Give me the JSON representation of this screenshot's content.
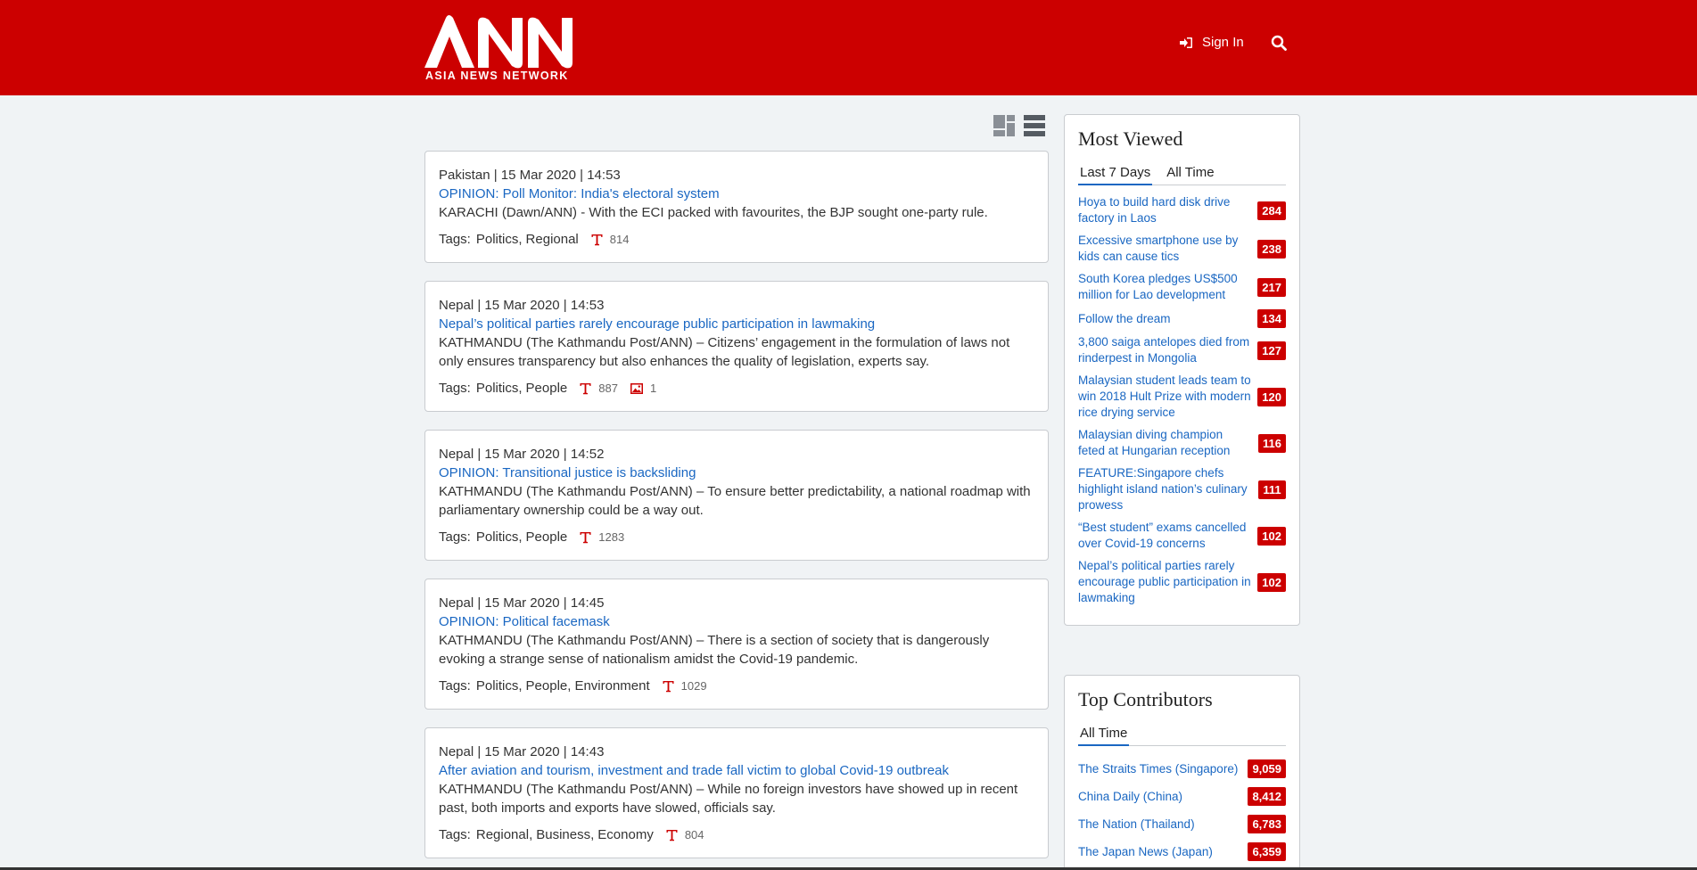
{
  "header": {
    "logo_main": "ANN",
    "logo_sub": "ASIA NEWS NETWORK",
    "signin_label": "Sign In"
  },
  "articles": [
    {
      "meta": "Pakistan | 15 Mar 2020 | 14:53",
      "title": "OPINION: Poll Monitor: India's electoral system",
      "summary": "KARACHI (Dawn/ANN) - With the ECI packed with favourites, the BJP sought one-party rule.",
      "tags_label": "Tags:",
      "tags": [
        "Politics",
        "Regional"
      ],
      "views": "814",
      "images": null
    },
    {
      "meta": "Nepal | 15 Mar 2020 | 14:53",
      "title": "Nepal’s political parties rarely encourage public participation in lawmaking",
      "summary": "KATHMANDU (The Kathmandu Post/ANN) – Citizens’ engagement in the formulation of laws not only ensures transparency but also enhances the quality of legislation, experts say.",
      "tags_label": "Tags:",
      "tags": [
        "Politics",
        "People"
      ],
      "views": "887",
      "images": "1"
    },
    {
      "meta": "Nepal | 15 Mar 2020 | 14:52",
      "title": "OPINION: Transitional justice is backsliding",
      "summary": "KATHMANDU (The Kathmandu Post/ANN) – To ensure better predictability, a national roadmap with parliamentary ownership could be a way out.",
      "tags_label": "Tags:",
      "tags": [
        "Politics",
        "People"
      ],
      "views": "1283",
      "images": null
    },
    {
      "meta": "Nepal | 15 Mar 2020 | 14:45",
      "title": "OPINION: Political facemask",
      "summary": "KATHMANDU (The Kathmandu Post/ANN) – There is a section of society that is dangerously evoking a strange sense of nationalism amidst the Covid-19 pandemic.",
      "tags_label": "Tags:",
      "tags": [
        "Politics",
        "People",
        "Environment"
      ],
      "views": "1029",
      "images": null
    },
    {
      "meta": "Nepal | 15 Mar 2020 | 14:43",
      "title": "After aviation and tourism, investment and trade fall victim to global Covid-19 outbreak",
      "summary": "KATHMANDU (The Kathmandu Post/ANN) – While no foreign investors have showed up in recent past, both imports and exports have slowed, officials say.",
      "tags_label": "Tags:",
      "tags": [
        "Regional",
        "Business",
        "Economy"
      ],
      "views": "804",
      "images": null
    }
  ],
  "most_viewed": {
    "title": "Most Viewed",
    "tabs": [
      "Last 7 Days",
      "All Time"
    ],
    "items": [
      {
        "label": "Hoya to build hard disk drive factory in Laos",
        "count": "284"
      },
      {
        "label": "Excessive smartphone use by kids can cause tics",
        "count": "238"
      },
      {
        "label": "South Korea pledges US$500 million for Lao development",
        "count": "217"
      },
      {
        "label": "Follow the dream",
        "count": "134"
      },
      {
        "label": "3,800 saiga antelopes died from rinderpest in Mongolia",
        "count": "127"
      },
      {
        "label": "Malaysian student leads team to win 2018 Hult Prize with modern rice drying service",
        "count": "120"
      },
      {
        "label": "Malaysian diving champion feted at Hungarian reception",
        "count": "116"
      },
      {
        "label": "FEATURE:Singapore chefs highlight island nation’s culinary prowess",
        "count": "111"
      },
      {
        "label": "“Best student” exams cancelled over Covid-19 concerns",
        "count": "102"
      },
      {
        "label": "Nepal’s political parties rarely encourage public participation in lawmaking",
        "count": "102"
      }
    ]
  },
  "top_contributors": {
    "title": "Top Contributors",
    "tabs": [
      "All Time"
    ],
    "items": [
      {
        "label": "The Straits Times (Singapore)",
        "count": "9,059"
      },
      {
        "label": "China Daily (China)",
        "count": "8,412"
      },
      {
        "label": "The Nation (Thailand)",
        "count": "6,783"
      },
      {
        "label": "The Japan News (Japan)",
        "count": "6,359"
      }
    ]
  },
  "colors": {
    "brand_red": "#cc0000",
    "link_blue": "#1a67c2",
    "background": "#f0f3f5"
  },
  "icons": [
    "signin-icon",
    "search-icon",
    "grid-view-icon",
    "list-view-icon",
    "text-icon",
    "image-icon"
  ]
}
